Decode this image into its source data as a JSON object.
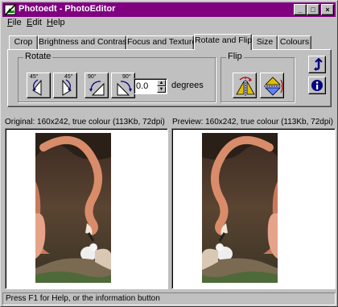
{
  "window": {
    "title": "Photoedt - PhotoEditor",
    "controls": {
      "minimize": "_",
      "maximize": "□",
      "close": "×"
    }
  },
  "menu": [
    {
      "label": "File",
      "accel": "F",
      "rest": "ile"
    },
    {
      "label": "Edit",
      "accel": "E",
      "rest": "dit"
    },
    {
      "label": "Help",
      "accel": "H",
      "rest": "elp"
    }
  ],
  "tabs": [
    {
      "label": "Crop",
      "active": false
    },
    {
      "label": "Brightness and Contrast",
      "active": false
    },
    {
      "label": "Focus and Texture",
      "active": false
    },
    {
      "label": "Rotate and Flip",
      "active": true
    },
    {
      "label": "Size",
      "active": false
    },
    {
      "label": "Colours",
      "active": false
    }
  ],
  "rotate": {
    "group_label": "Rotate",
    "buttons": [
      {
        "degrees": "45°",
        "icon": "rotate-45-left-icon"
      },
      {
        "degrees": "45°",
        "icon": "rotate-45-right-icon"
      },
      {
        "degrees": "90°",
        "icon": "rotate-90-left-icon"
      },
      {
        "degrees": "90°",
        "icon": "rotate-90-right-icon"
      }
    ],
    "angle_value": "0.0",
    "unit_label": "degrees"
  },
  "flip": {
    "group_label": "Flip",
    "buttons": [
      {
        "icon": "flip-horizontal-icon"
      },
      {
        "icon": "flip-vertical-icon"
      }
    ]
  },
  "side_buttons": [
    {
      "icon": "undo-icon"
    },
    {
      "icon": "info-icon"
    }
  ],
  "original": {
    "caption": "Original: 160x242, true colour (113Kb, 72dpi)"
  },
  "preview": {
    "caption": "Preview: 160x242, true colour (113Kb, 72dpi)"
  },
  "status": {
    "text": "Press F1 for Help, or the information button"
  },
  "colors": {
    "titlebar": "#800080",
    "face": "#c0c0c0"
  }
}
